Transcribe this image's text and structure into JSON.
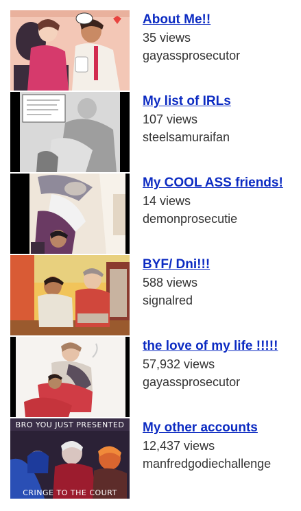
{
  "videos": [
    {
      "title": "About Me!!",
      "views": "35 views",
      "channel": "gayassprosecutor",
      "thumbnail_icon": "anime-characters-couch-thumbnail"
    },
    {
      "title": "My list of IRLs",
      "views": "107 views",
      "channel": "steelsamuraifan",
      "thumbnail_icon": "grayscale-comic-thumbnail"
    },
    {
      "title": "My COOL ASS friends!",
      "views": "14 views",
      "channel": "demonprosecutie",
      "thumbnail_icon": "anime-characters-embrace-thumbnail"
    },
    {
      "title": "BYF/ Dni!!!",
      "views": "588 views",
      "channel": "signalred",
      "thumbnail_icon": "anime-characters-street-thumbnail"
    },
    {
      "title": "the love of my life !!!!!",
      "views": "57,932 views",
      "channel": "gayassprosecutor",
      "thumbnail_icon": "anime-characters-sketch-thumbnail"
    },
    {
      "title": "My other accounts",
      "views": "12,437 views",
      "channel": "manfredgodiechallenge",
      "thumbnail_icon": "meme-courtroom-thumbnail",
      "caption_top": "BRO YOU JUST PRESENTED",
      "caption_bottom": "CRINGE TO THE COURT"
    }
  ]
}
